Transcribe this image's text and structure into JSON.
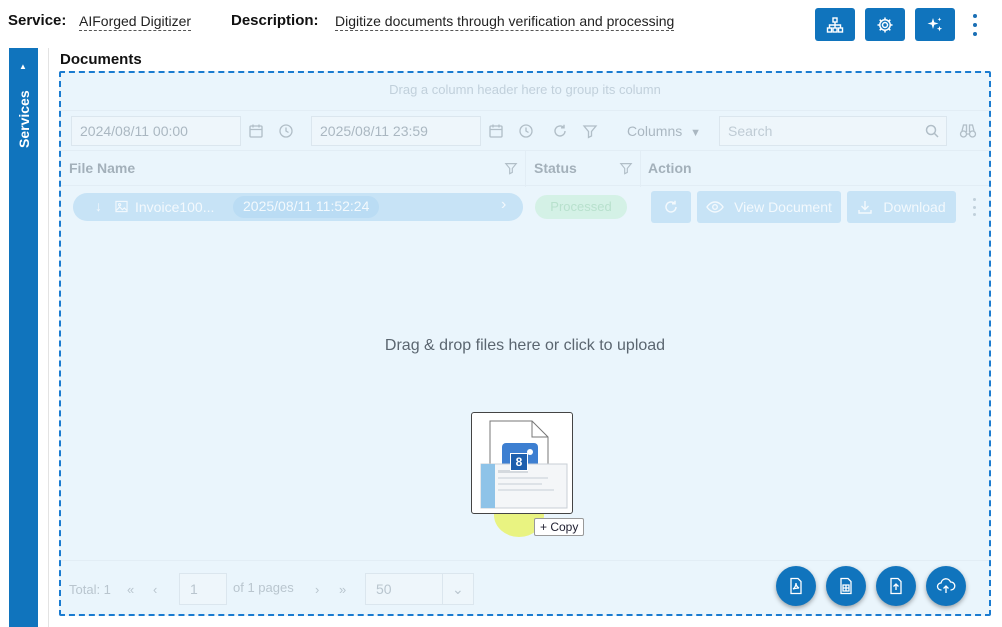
{
  "header": {
    "service_label": "Service:",
    "service_value": "AIForged Digitizer",
    "description_label": "Description:",
    "description_value": "Digitize documents through verification and processing",
    "buttons": [
      "hierarchy-icon",
      "gear-icon",
      "sparkle-icon",
      "more-vertical-icon"
    ],
    "accent": "#1074bd"
  },
  "sidebar": {
    "label": "Services",
    "marker": "▲"
  },
  "documents": {
    "title": "Documents",
    "group_hint": "Drag a column header here to group its column",
    "filters": {
      "date_from": "2024/08/11 00:00",
      "date_to": "2025/08/11 23:59",
      "columns_label": "Columns",
      "search_placeholder": "Search"
    },
    "columns": [
      "File Name",
      "Status",
      "Action"
    ],
    "rows": [
      {
        "file_name": "Invoice100...",
        "date": "2025/08/11 11:52:24",
        "status": "Processed",
        "actions": {
          "view": "View Document",
          "download": "Download"
        }
      }
    ],
    "drop_text": "Drag & drop files here or click to upload",
    "drag_preview": {
      "count": "8",
      "copy_label": "+ Copy"
    },
    "pager": {
      "total": "Total: 1",
      "page": "1",
      "of_pages": "of 1 pages",
      "page_size": "50"
    }
  }
}
